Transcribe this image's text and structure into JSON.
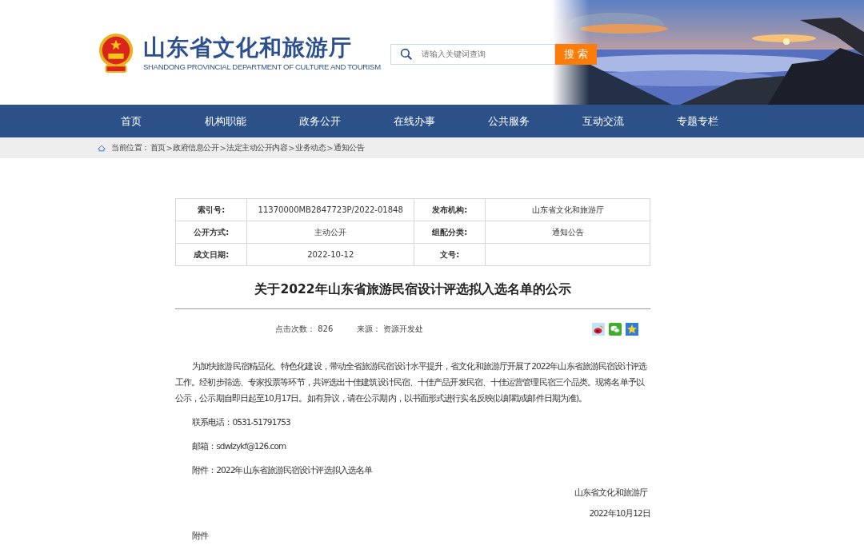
{
  "header": {
    "title": "山东省文化和旅游厅",
    "subtitle": "SHANDONG PROVINCIAL DEPARTMENT OF CULTURE AND TOURISM",
    "search": {
      "placeholder": "请输入关键词查询",
      "button": "搜 索"
    }
  },
  "nav": [
    {
      "label": "首页",
      "selected": false
    },
    {
      "label": "机构职能",
      "selected": false
    },
    {
      "label": "政务公开",
      "selected": false
    },
    {
      "label": "在线办事",
      "selected": false
    },
    {
      "label": "公共服务",
      "selected": false
    },
    {
      "label": "互动交流",
      "selected": false
    },
    {
      "label": "专题专栏",
      "selected": false
    }
  ],
  "breadcrumb": {
    "label": "当前位置：",
    "separator": ">",
    "items": [
      "首页",
      "政府信息公开",
      "法定主动公开内容",
      "业务动态",
      "通知公告"
    ]
  },
  "info_table": [
    [
      "索引号:",
      "11370000MB2847723P/2022-01848",
      "发布机构:",
      "山东省文化和旅游厅"
    ],
    [
      "公开方式:",
      "主动公开",
      "组配分类:",
      "通知公告"
    ],
    [
      "成文日期:",
      "2022-10-12",
      "文号:"
    ]
  ],
  "article": {
    "title": "关于2022年山东省旅游民宿设计评选拟入选名单的公示",
    "meta": [
      {
        "label": "点击次数：",
        "value": "826"
      },
      {
        "label": "来源：",
        "value": "资源开发处"
      }
    ],
    "share": [
      {
        "kind": "weibo"
      },
      {
        "kind": "wechat"
      },
      {
        "kind": "favorite"
      }
    ],
    "paragraphs": [
      "为加快旅游民宿精品化、特色化建设，带动全省旅游民宿设计水平提升，省文化和旅游厅开展了2022年山东省旅游民宿设计评选工作。经初步筛选、专家投票等环节，共评选出十佳建筑设计民宿、十佳产品开发民宿、十佳运营管理民宿三个品类。现将名单予以公示，公示期自即日起至10月17日。如有异议，请在公示期内，以书面形式进行实名反映(以邮戳或邮件日期为准)。",
      "联系电话：0531-51791753",
      "邮箱：sdwlzykf@126.com",
      "附件：2022年山东省旅游民宿设计评选拟入选名单"
    ],
    "signature": "山东省文化和旅游厅",
    "date": "2022年10月12日",
    "trailing": "附件"
  }
}
